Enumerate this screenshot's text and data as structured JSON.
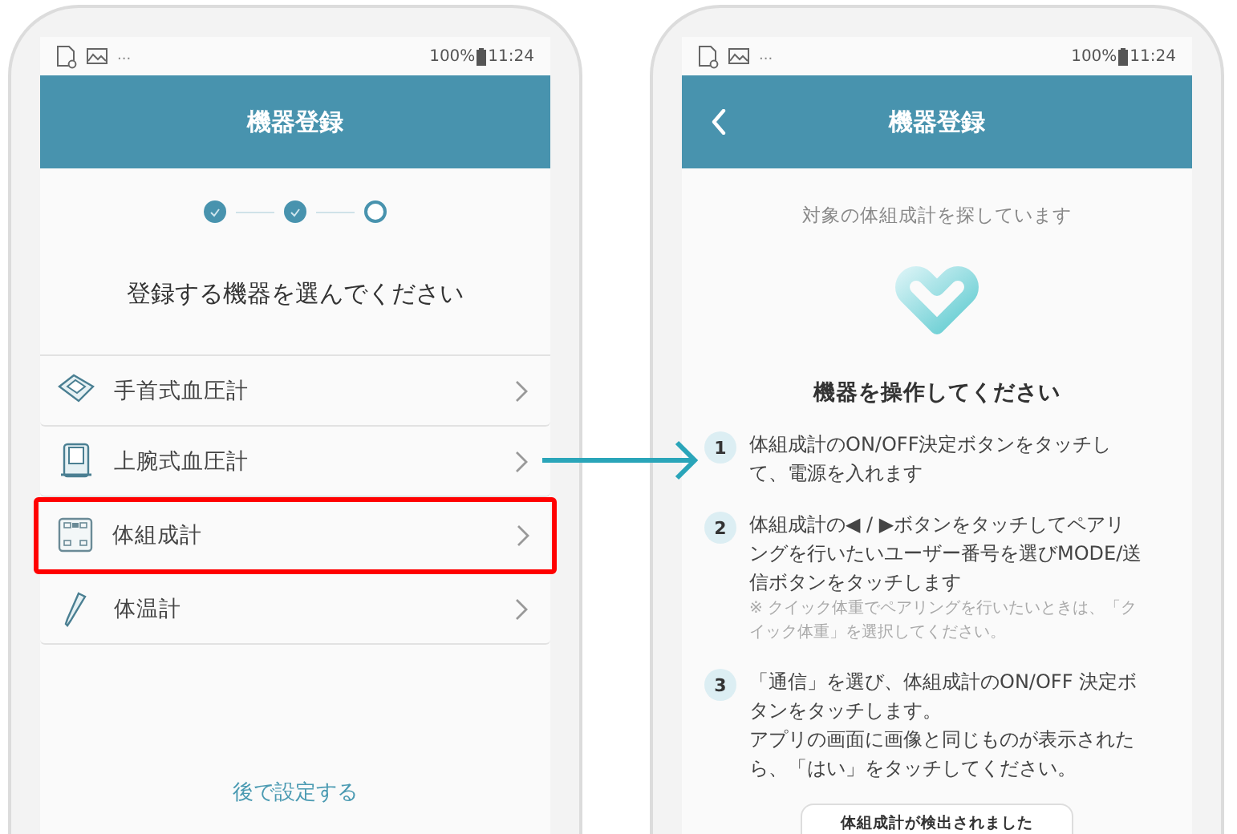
{
  "left_screen": {
    "status_bar": {
      "overflow": "...",
      "battery": "100%",
      "time": "11:24"
    },
    "header": {
      "title": "機器登録",
      "back": false
    },
    "steps": [
      {
        "done": true
      },
      {
        "done": true
      },
      {
        "done": false
      }
    ],
    "prompt": "登録する機器を選んでください",
    "devices": [
      {
        "kind": "wrist",
        "label": "手首式血圧計",
        "highlighted": false
      },
      {
        "kind": "arm",
        "label": "上腕式血圧計",
        "highlighted": false
      },
      {
        "kind": "scale",
        "label": "体組成計",
        "highlighted": true
      },
      {
        "kind": "thermometer",
        "label": "体温計",
        "highlighted": false
      }
    ],
    "later_link": "後で設定する"
  },
  "right_screen": {
    "status_bar": {
      "overflow": "...",
      "battery": "100%",
      "time": "11:24"
    },
    "header": {
      "title": "機器登録",
      "back": true
    },
    "searching": "対象の体組成計を探しています",
    "heading": "機器を操作してください",
    "instructions": [
      {
        "number": "1",
        "paragraphs": [
          "体組成計のON/OFF決定ボタンをタッチして、電源を入れます"
        ]
      },
      {
        "number": "2",
        "paragraphs": [
          "体組成計の◀ / ▶ボタンをタッチしてペアリングを行いたいユーザー番号を選びMODE/送信ボタンをタッチします"
        ],
        "note": "※ クイック体重でペアリングを行いたいときは、「クイック体重」を選択してください。"
      },
      {
        "number": "3",
        "paragraphs": [
          "「通信」を選び、体組成計のON/OFF 決定ボタンをタッチします。",
          "アプリの画面に画像と同じものが表示されたら、「はい」をタッチしてください。"
        ]
      }
    ],
    "detected_button": "体組成計が検出されました"
  }
}
